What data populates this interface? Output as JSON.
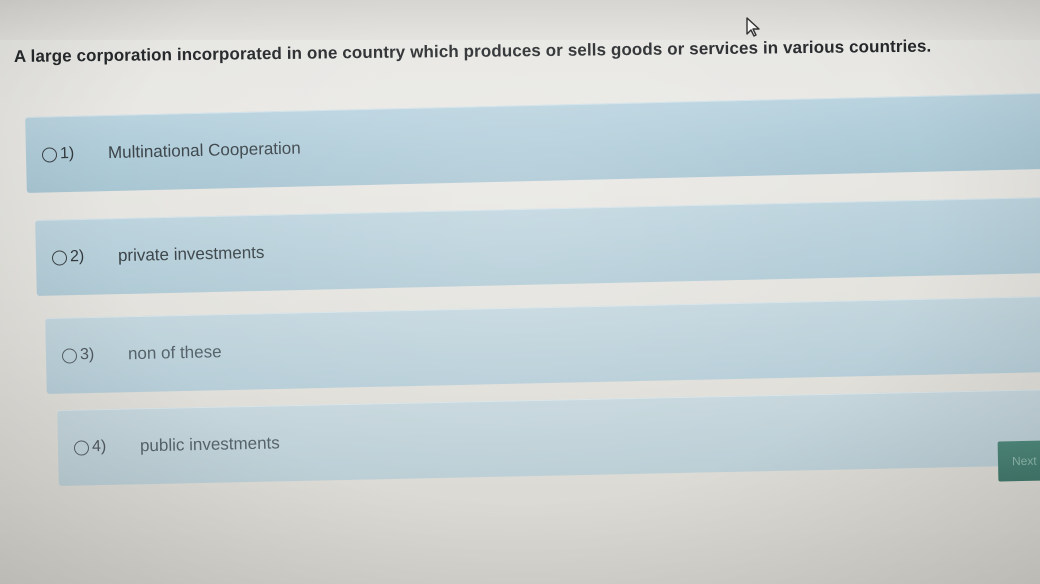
{
  "cursor": {
    "icon": "mouse-pointer-icon"
  },
  "question": {
    "text": "A large corporation incorporated in one country which produces or sells goods or services in various countries."
  },
  "options": [
    {
      "number": "1)",
      "label": "Multinational Cooperation"
    },
    {
      "number": "2)",
      "label": "private investments"
    },
    {
      "number": "3)",
      "label": "non of these"
    },
    {
      "number": "4)",
      "label": "public investments"
    }
  ],
  "next_button": {
    "label": "Next"
  },
  "colors": {
    "option_background": "#b1cbd6",
    "next_button": "#4a8374",
    "question_text": "#26292b"
  }
}
